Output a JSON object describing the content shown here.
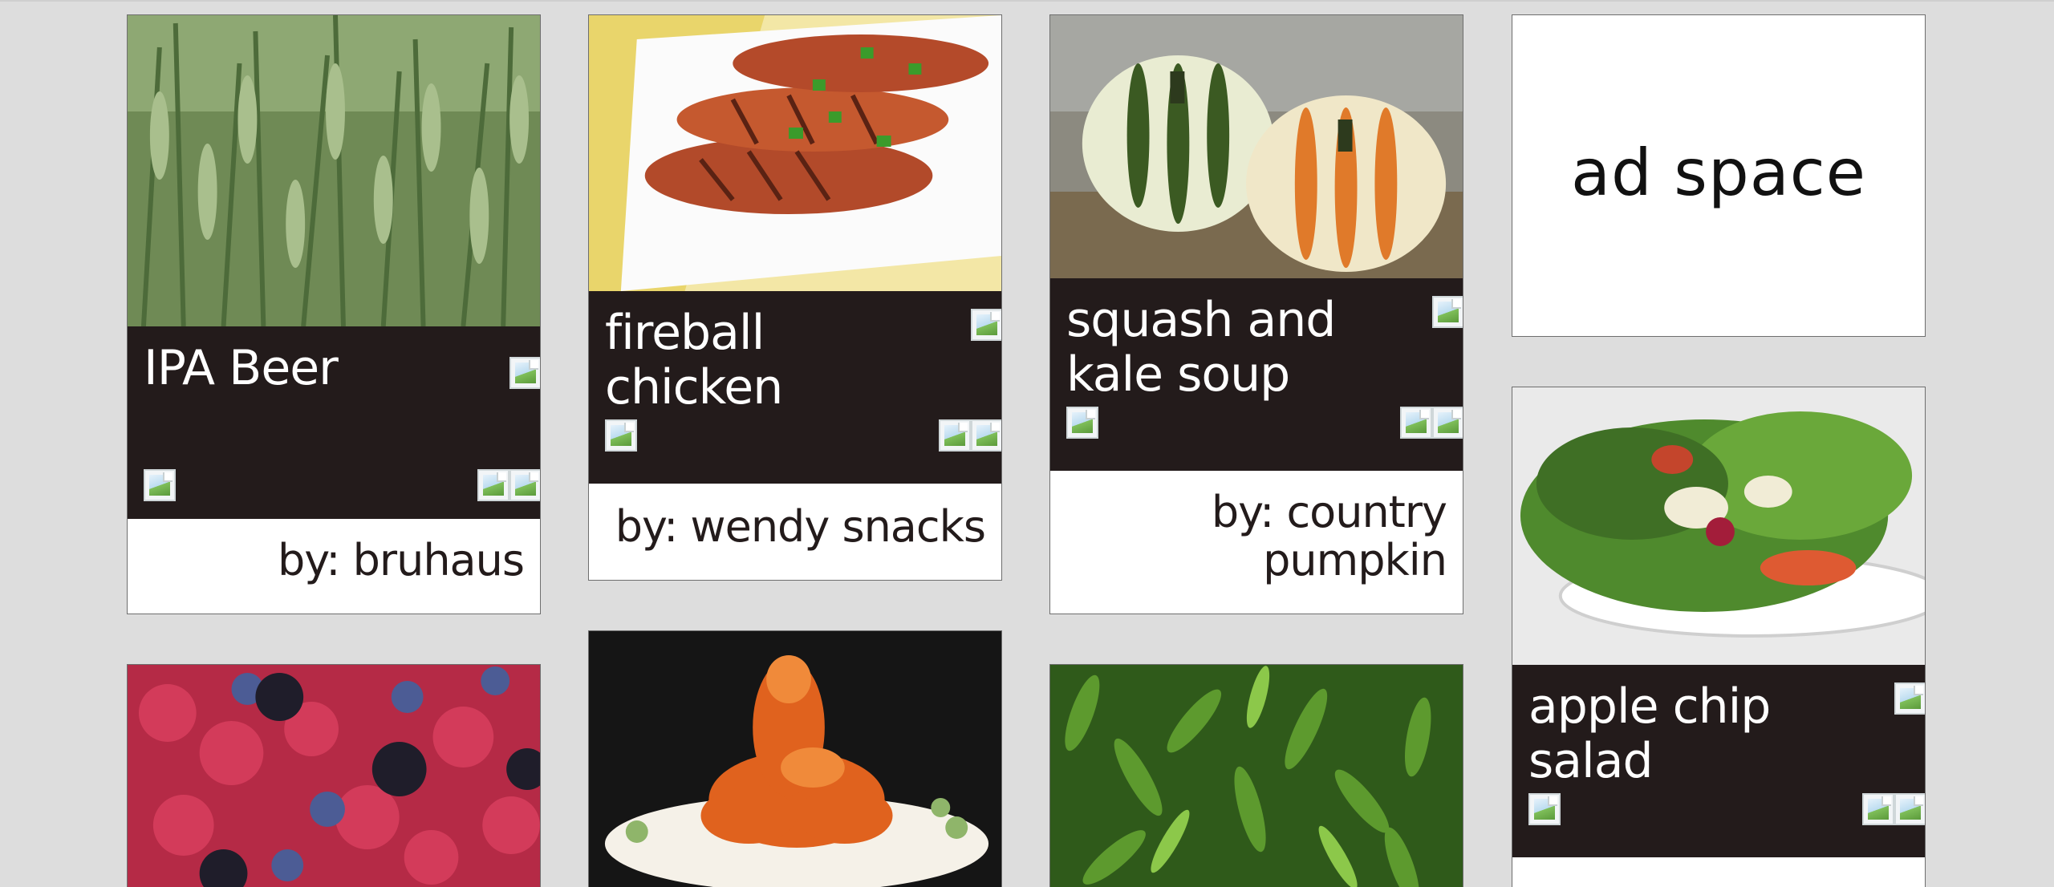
{
  "cards": [
    {
      "id": "ipa-beer",
      "title": "IPA Beer",
      "author": "by: bruhaus",
      "image": "barley-field-photo"
    },
    {
      "id": "fireball-chicken",
      "title": "fireball chicken",
      "author": "by: wendy snacks",
      "image": "grilled-chicken-photo"
    },
    {
      "id": "squash-soup",
      "title": "squash and kale soup",
      "author": "by: country pumpkin",
      "image": "squash-photo"
    },
    {
      "id": "apple-chip-salad",
      "title": "apple chip salad",
      "author": "",
      "image": "salad-photo"
    },
    {
      "id": "berries",
      "title": "",
      "author": "",
      "image": "berries-photo"
    },
    {
      "id": "orange-chicken",
      "title": "",
      "author": "",
      "image": "orange-chicken-photo"
    },
    {
      "id": "peppers",
      "title": "",
      "author": "",
      "image": "green-peppers-photo"
    }
  ],
  "ad": {
    "text": "ad space"
  },
  "icons": {
    "broken_image": "broken-image-icon"
  },
  "colors": {
    "band": "#231b1b",
    "background": "#dddddd",
    "card_border": "#6e6e6e"
  }
}
